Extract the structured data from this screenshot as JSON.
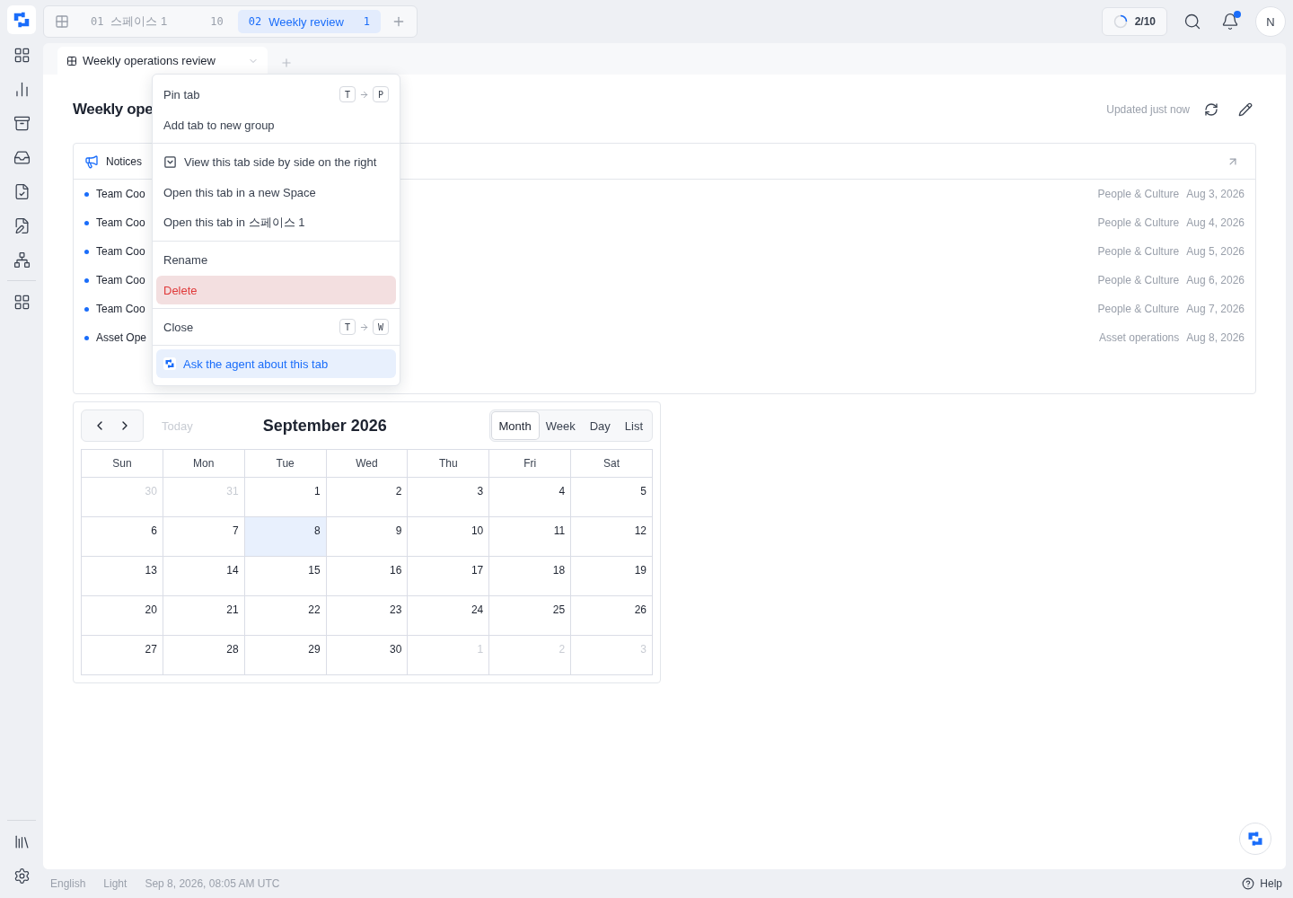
{
  "spaces": [
    {
      "number": "01",
      "name": "스페이스 1",
      "count": "10",
      "selected": false
    },
    {
      "number": "02",
      "name": "Weekly review",
      "count": "1",
      "selected": true
    }
  ],
  "top_right": {
    "progress": "2/10",
    "has_unread": true,
    "avatar": "N"
  },
  "page_tab": {
    "label": "Weekly operations review"
  },
  "context_menu": {
    "sections": [
      [
        {
          "label": "Pin tab",
          "kind": "normal",
          "shortcut": [
            "T",
            "P"
          ]
        },
        {
          "label": "Add tab to new group",
          "kind": "normal"
        }
      ],
      [
        {
          "label": "View this tab side by side on the right",
          "kind": "split"
        },
        {
          "label": "Open this tab in a new Space",
          "kind": "normal"
        },
        {
          "label": "Open this tab in 스페이스 1",
          "kind": "normal"
        }
      ],
      [
        {
          "label": "Rename",
          "kind": "normal"
        },
        {
          "label": "Delete",
          "kind": "danger"
        }
      ],
      [
        {
          "label": "Close",
          "kind": "normal",
          "shortcut": [
            "T",
            "W"
          ]
        }
      ],
      [
        {
          "label": "Ask the agent about this tab",
          "kind": "agent"
        }
      ]
    ]
  },
  "page": {
    "title": "Weekly ope",
    "updated": "Updated just now"
  },
  "notices": {
    "title": "Notices",
    "rows": [
      {
        "title": "Team Coo",
        "category": "People & Culture",
        "date": "Aug 3, 2026"
      },
      {
        "title": "Team Coo",
        "category": "People & Culture",
        "date": "Aug 4, 2026"
      },
      {
        "title": "Team Coo",
        "category": "People & Culture",
        "date": "Aug 5, 2026"
      },
      {
        "title": "Team Coo",
        "category": "People & Culture",
        "date": "Aug 6, 2026"
      },
      {
        "title": "Team Coo",
        "category": "People & Culture",
        "date": "Aug 7, 2026"
      },
      {
        "title": "Asset Ope",
        "category": "Asset operations",
        "date": "Aug 8, 2026"
      }
    ]
  },
  "calendar": {
    "today": "Today",
    "title": "September 2026",
    "views": [
      {
        "label": "Month",
        "selected": true
      },
      {
        "label": "Week",
        "selected": false
      },
      {
        "label": "Day",
        "selected": false
      },
      {
        "label": "List",
        "selected": false
      }
    ],
    "weekdays": [
      "Sun",
      "Mon",
      "Tue",
      "Wed",
      "Thu",
      "Fri",
      "Sat"
    ],
    "weeks": [
      [
        {
          "day": "30",
          "outside": true,
          "selected": false
        },
        {
          "day": "31",
          "outside": true,
          "selected": false
        },
        {
          "day": "1",
          "outside": false,
          "selected": false
        },
        {
          "day": "2",
          "outside": false,
          "selected": false
        },
        {
          "day": "3",
          "outside": false,
          "selected": false
        },
        {
          "day": "4",
          "outside": false,
          "selected": false
        },
        {
          "day": "5",
          "outside": false,
          "selected": false
        }
      ],
      [
        {
          "day": "6",
          "outside": false,
          "selected": false
        },
        {
          "day": "7",
          "outside": false,
          "selected": false
        },
        {
          "day": "8",
          "outside": false,
          "selected": true
        },
        {
          "day": "9",
          "outside": false,
          "selected": false
        },
        {
          "day": "10",
          "outside": false,
          "selected": false
        },
        {
          "day": "11",
          "outside": false,
          "selected": false
        },
        {
          "day": "12",
          "outside": false,
          "selected": false
        }
      ],
      [
        {
          "day": "13",
          "outside": false,
          "selected": false
        },
        {
          "day": "14",
          "outside": false,
          "selected": false
        },
        {
          "day": "15",
          "outside": false,
          "selected": false
        },
        {
          "day": "16",
          "outside": false,
          "selected": false
        },
        {
          "day": "17",
          "outside": false,
          "selected": false
        },
        {
          "day": "18",
          "outside": false,
          "selected": false
        },
        {
          "day": "19",
          "outside": false,
          "selected": false
        }
      ],
      [
        {
          "day": "20",
          "outside": false,
          "selected": false
        },
        {
          "day": "21",
          "outside": false,
          "selected": false
        },
        {
          "day": "22",
          "outside": false,
          "selected": false
        },
        {
          "day": "23",
          "outside": false,
          "selected": false
        },
        {
          "day": "24",
          "outside": false,
          "selected": false
        },
        {
          "day": "25",
          "outside": false,
          "selected": false
        },
        {
          "day": "26",
          "outside": false,
          "selected": false
        }
      ],
      [
        {
          "day": "27",
          "outside": false,
          "selected": false
        },
        {
          "day": "28",
          "outside": false,
          "selected": false
        },
        {
          "day": "29",
          "outside": false,
          "selected": false
        },
        {
          "day": "30",
          "outside": false,
          "selected": false
        },
        {
          "day": "1",
          "outside": true,
          "selected": false
        },
        {
          "day": "2",
          "outside": true,
          "selected": false
        },
        {
          "day": "3",
          "outside": true,
          "selected": false
        }
      ]
    ]
  },
  "status_bar": {
    "language": "English",
    "theme": "Light",
    "datetime": "Sep 8, 2026, 08:05 AM UTC",
    "help": "Help"
  }
}
